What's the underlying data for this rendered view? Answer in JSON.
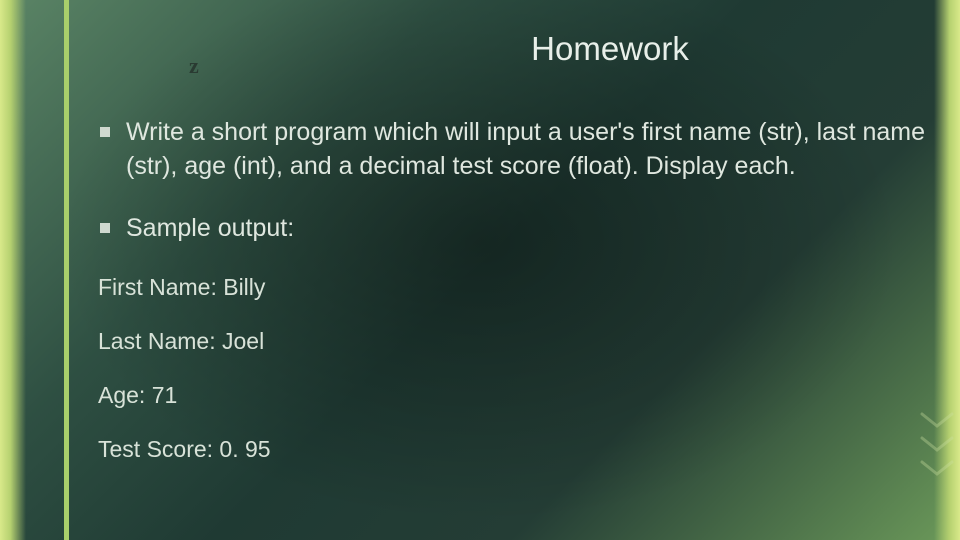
{
  "ornament": "z",
  "title": "Homework",
  "bullets": [
    "Write a short program which will input a user's first name (str), last name (str), age (int), and a decimal test score (float). Display each.",
    "Sample output:"
  ],
  "sample": {
    "line1": "First Name: Billy",
    "line2": "Last Name: Joel",
    "line3": "Age: 71",
    "line4": "Test Score: 0. 95"
  }
}
